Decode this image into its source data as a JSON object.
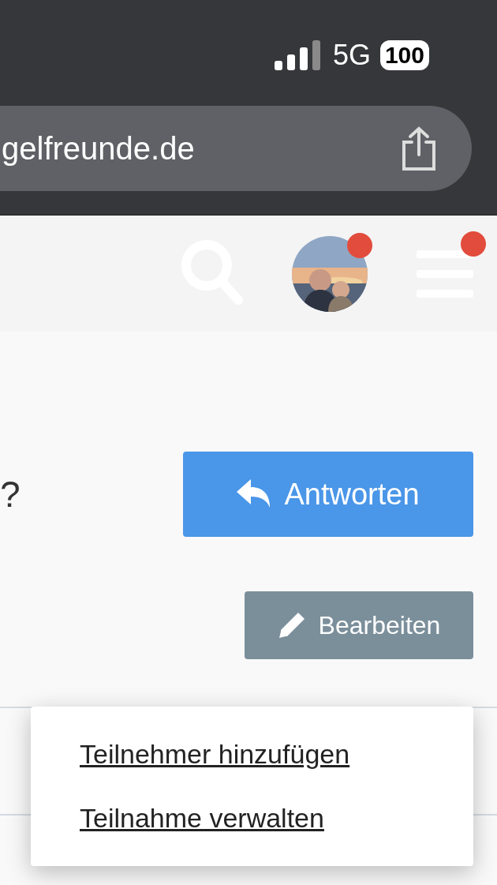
{
  "status_bar": {
    "network": "5G",
    "battery": "100"
  },
  "address_bar": {
    "url": "gelfreunde.de"
  },
  "header": {
    "avatar": {
      "kind": "picture",
      "notification": true
    },
    "menu": {
      "notification": true
    }
  },
  "question_fragment": "?",
  "buttons": [
    {
      "label": "Antworten",
      "kind": "primary"
    },
    {
      "label": "Bearbeiten",
      "kind": "secondary"
    }
  ],
  "dropdown": {
    "items": [
      {
        "label": "Teilnehmer hinzufügen"
      },
      {
        "label": "Teilnahme verwalten"
      }
    ]
  }
}
